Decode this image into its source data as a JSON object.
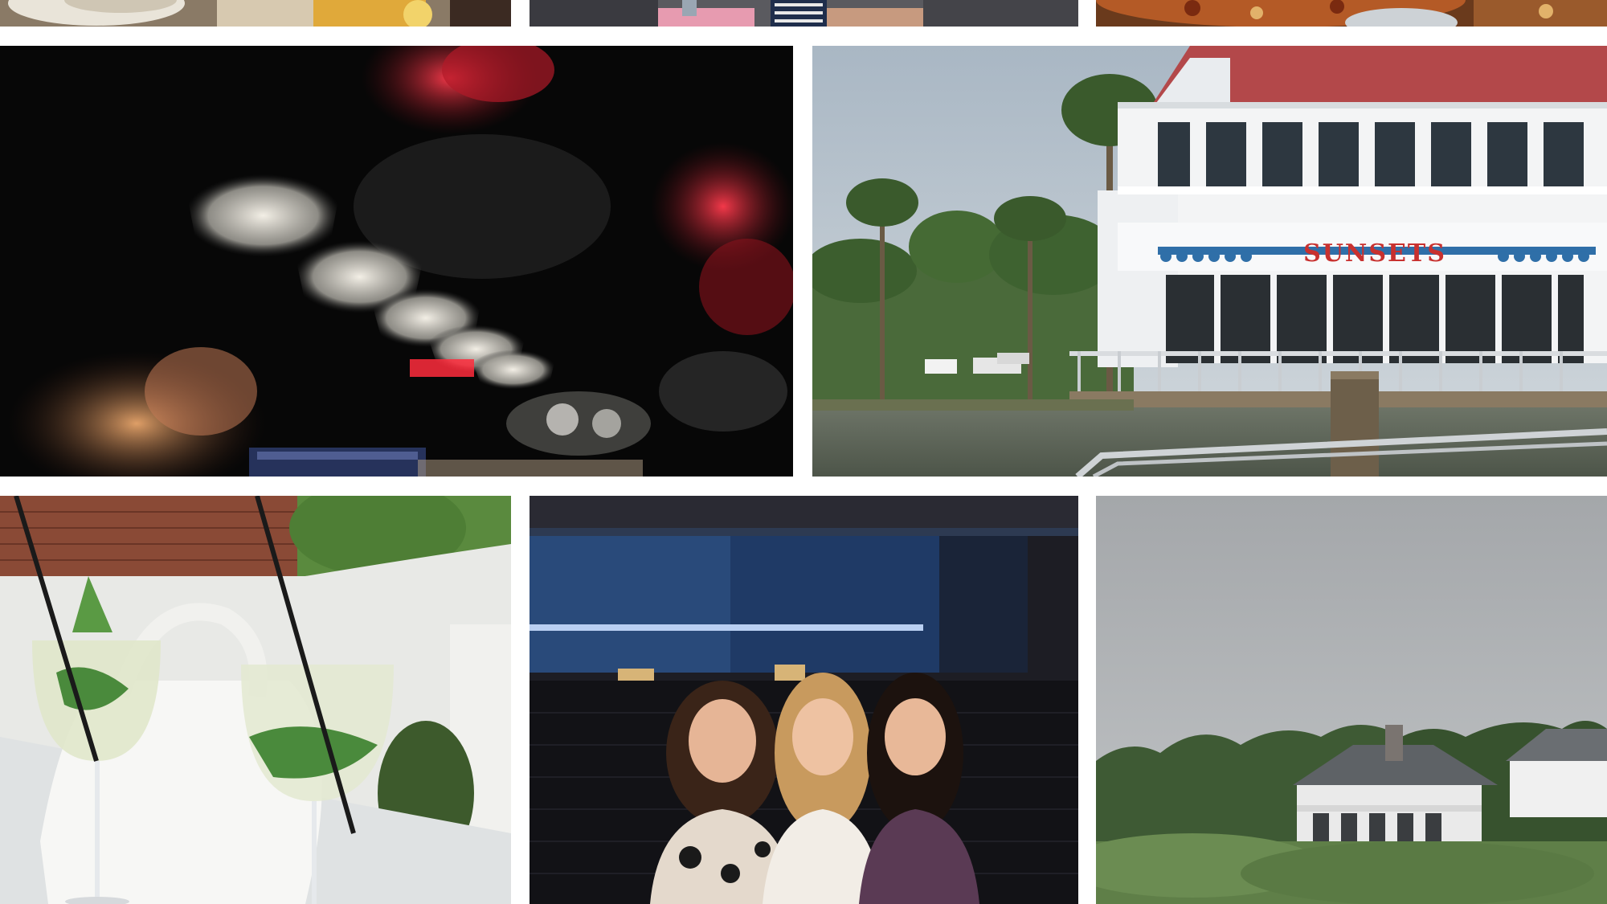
{
  "collage": {
    "tiles": [
      {
        "id": "top-left",
        "description_icon": "drink-table-photo"
      },
      {
        "id": "top-mid",
        "description_icon": "car-interior-photo"
      },
      {
        "id": "top-right",
        "description_icon": "pizza-photo"
      },
      {
        "id": "mid-left",
        "description_icon": "blurry-bar-lights-photo"
      },
      {
        "id": "mid-right",
        "description_icon": "waterfront-restaurant-photo"
      },
      {
        "id": "bot-left",
        "description_icon": "mojito-glasses-photo"
      },
      {
        "id": "bot-mid",
        "description_icon": "three-friends-photo"
      },
      {
        "id": "bot-right",
        "description_icon": "marsh-house-photo"
      }
    ]
  },
  "signage": {
    "restaurant_sign": "SUNSETS"
  },
  "colors": {
    "background": "#ffffff",
    "sign_red": "#c8312f",
    "roof_red": "#b3484a",
    "sign_blue": "#2f6fa8"
  }
}
